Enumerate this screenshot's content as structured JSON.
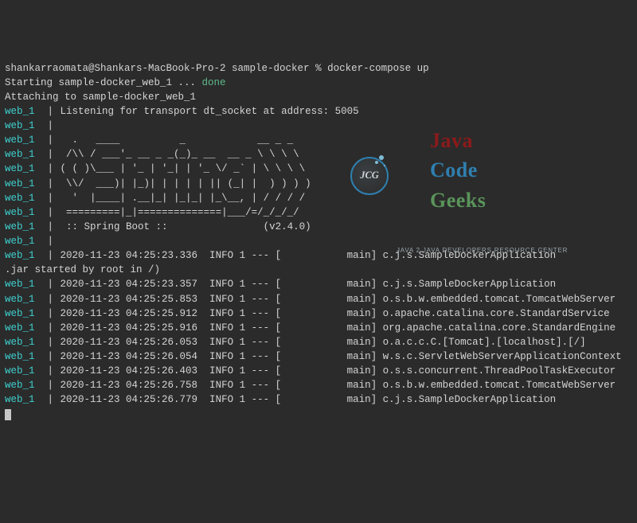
{
  "terminal": {
    "prompt_user_host": "shankarraomata@Shankars-MacBook-Pro-2",
    "prompt_path": "sample-docker",
    "prompt_symbol": "%",
    "command": "docker-compose up",
    "starting_text": "Starting sample-docker_web_1 ...",
    "done_text": "done",
    "attaching_text": "Attaching to sample-docker_web_1",
    "prefix": "web_1",
    "pipe": "|",
    "banner_lines": [
      "Listening for transport dt_socket at address: 5005",
      "",
      "  .   ____          _            __ _ _",
      " /\\\\ / ___'_ __ _ _(_)_ __  __ _ \\ \\ \\ \\",
      "( ( )\\___ | '_ | '_| | '_ \\/ _` | \\ \\ \\ \\",
      " \\\\/  ___)| |_)| | | | | || (_| |  ) ) ) )",
      "  '  |____| .__|_| |_|_| |_\\__, | / / / /",
      " =========|_|==============|___/=/_/_/_/",
      " :: Spring Boot ::                (v2.4.0)",
      ""
    ],
    "wrap_line": ".jar started by root in /)",
    "log_lines": [
      "2020-11-23 04:25:23.336  INFO 1 --- [           main] c.j.s.SampleDockerApplication",
      "2020-11-23 04:25:23.357  INFO 1 --- [           main] c.j.s.SampleDockerApplication",
      "2020-11-23 04:25:25.853  INFO 1 --- [           main] o.s.b.w.embedded.tomcat.TomcatWebServer",
      "2020-11-23 04:25:25.912  INFO 1 --- [           main] o.apache.catalina.core.StandardService",
      "2020-11-23 04:25:25.916  INFO 1 --- [           main] org.apache.catalina.core.StandardEngine",
      "2020-11-23 04:25:26.053  INFO 1 --- [           main] o.a.c.c.C.[Tomcat].[localhost].[/]",
      "2020-11-23 04:25:26.054  INFO 1 --- [           main] w.s.c.ServletWebServerApplicationContext",
      "2020-11-23 04:25:26.403  INFO 1 --- [           main] o.s.s.concurrent.ThreadPoolTaskExecutor",
      "2020-11-23 04:25:26.758  INFO 1 --- [           main] o.s.b.w.embedded.tomcat.TomcatWebServer",
      "2020-11-23 04:25:26.779  INFO 1 --- [           main] c.j.s.SampleDockerApplication"
    ]
  },
  "logo": {
    "badge_text": "JCG",
    "word_java": "Java",
    "word_code": "Code",
    "word_geeks": "Geeks",
    "subtitle": "Java 2 Java Developers Resource Center"
  }
}
